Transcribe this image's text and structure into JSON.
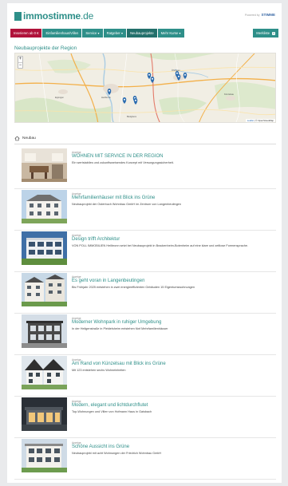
{
  "header": {
    "logo_name": "immostimme",
    "logo_domain": ".de",
    "powered_label": "Powered by",
    "powered_brand": "STIMME"
  },
  "nav": {
    "items": [
      "Inserieren ab 0 €",
      "Einfamilienhaus/Villen",
      "Service ▾",
      "Ratgeber ▾",
      "Neubauprojekte",
      "Mehr Kurse ▾"
    ],
    "merkliste_label": "Merkliste",
    "merkliste_count": "0"
  },
  "section_title": "Neubauprojekte der Region",
  "map": {
    "zoom_in": "+",
    "zoom_out": "−",
    "attribution_leaflet": "Leaflet",
    "attribution_rest": " | © OpenStreetMap",
    "marker_count": 9
  },
  "list": {
    "heading": "Neubau",
    "items": [
      {
        "tag": "Anzeige",
        "title": "WOHNEN MIT SERVICE IN DER REGION",
        "desc": "Ein wertstabiles und zukunftsweisendes Konzept mit Versorgungssicherheit."
      },
      {
        "tag": "Anzeige",
        "title": "Mehrfamilienhäuser mit Blick ins Grüne",
        "desc": "Neubauprojekt der Osterbuch Wohnbau GmbH im Zentrum von Langenbeutingen"
      },
      {
        "tag": "Anzeige",
        "title": "Design trifft Architektur",
        "desc": "VON POLL IMMOBILIEN Heilbronn setzt bei Neubauprojekt in Brackenheim-Botenheim auf eine klare und zeitlose Formensprache."
      },
      {
        "tag": "Anzeige",
        "title": "Es geht voran in Langenbeutingen",
        "desc": "Bis Frühjahr 2025 entstehen in zwei energieeffizienten Gebäuden 15 Eigentumswohnungen"
      },
      {
        "tag": "Anzeige",
        "title": "Moderner Wohnpark in ruhiger Umgebung",
        "desc": "In der Heilgenstraße in Pleidelsheim entstehen fünf Mehrfamilienhäuser"
      },
      {
        "tag": "Anzeige",
        "title": "Am Rand von Künzelsau mit Blick ins Grüne",
        "desc": "Mit 123 entstehen sechs Wohneinheiten"
      },
      {
        "tag": "Anzeige",
        "title": "Modern, elegant und lichtdurchflutet",
        "desc": "Top-Wohnungen und Villen von Hofmann Haus in Gaisbach"
      },
      {
        "tag": "Anzeige",
        "title": "Schöne Aussicht ins Grüne",
        "desc": "Neubauprojekt mit acht Wohnungen der Friedrich Wohnbau GmbH"
      }
    ]
  },
  "colors": {
    "brand": "#2e8f89",
    "primary_button": "#b0123a",
    "marker": "#2b6cb0"
  }
}
